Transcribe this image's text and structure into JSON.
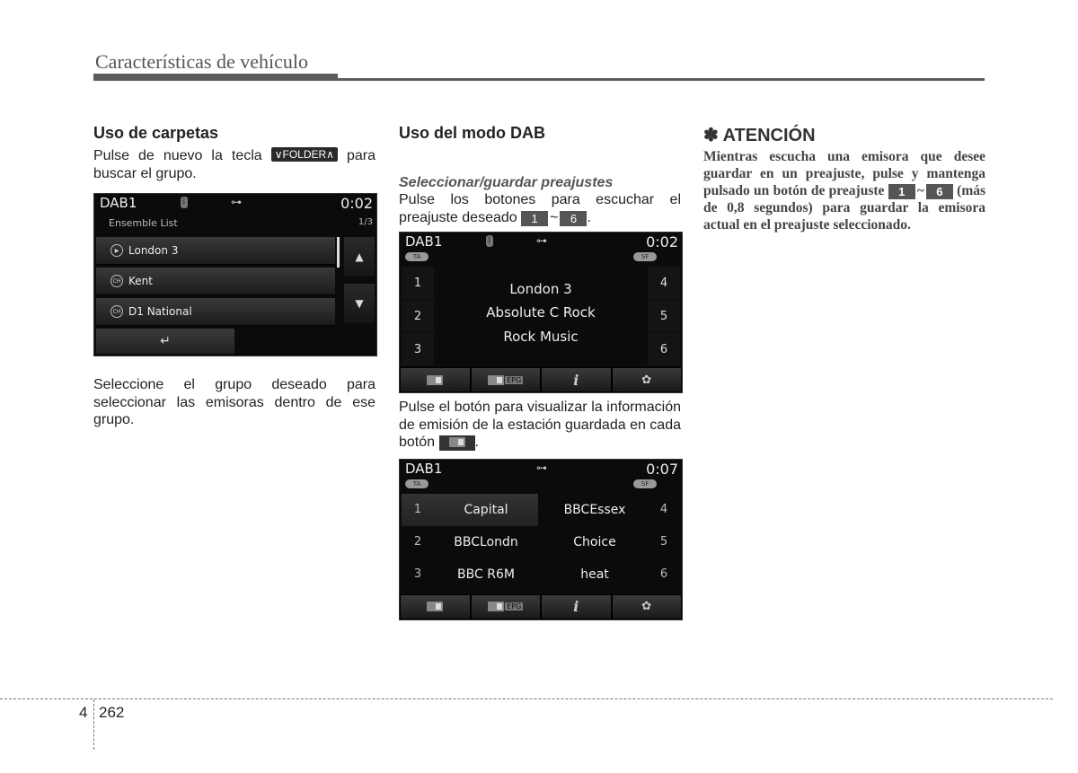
{
  "header": {
    "title": "Características de vehículo"
  },
  "column1": {
    "heading": "Uso de carpetas",
    "para1_before": "Pulse de nuevo la tecla",
    "folder_key": "∨FOLDER∧",
    "para1_after": "para buscar el grupo.",
    "screen": {
      "mode": "DAB1",
      "time": "0:02",
      "subtitle": "Ensemble List",
      "page": "1/3",
      "items": [
        {
          "icon": "play-icon",
          "label": "London 3"
        },
        {
          "icon": "channel-icon",
          "label": "Kent"
        },
        {
          "icon": "channel-icon",
          "label": "D1 National"
        }
      ],
      "up_arrow": "▲",
      "down_arrow": "▼",
      "back_icon": "↵"
    },
    "para2": "Seleccione el grupo deseado para seleccionar las emisoras dentro de ese grupo."
  },
  "column2": {
    "heading": "Uso del modo DAB",
    "subheading": "Seleccionar/guardar preajustes",
    "para1_before": "Pulse los botones  para escuchar el preajuste deseado",
    "key_from": "1",
    "key_sep": "~",
    "key_to": "6",
    "para1_after": ".",
    "screen2": {
      "mode": "DAB1",
      "time": "0:02",
      "ta": "TA",
      "sf": "SF",
      "presets_left": [
        "1",
        "2",
        "3"
      ],
      "presets_right": [
        "4",
        "5",
        "6"
      ],
      "lines": [
        "London 3",
        "Absolute C Rock",
        "Rock Music"
      ],
      "toolbar": [
        "radio-icon",
        "epg-icon",
        "info-icon",
        "gear-icon"
      ],
      "epg_label": "EPG",
      "info_label": "i",
      "gear_label": "✿"
    },
    "para2_before": "Pulse el botón  para visualizar la información de emisión de la estación guardada en cada botón",
    "para2_after": ".",
    "screen3": {
      "mode": "DAB1",
      "time": "0:07",
      "ta": "TA",
      "sf": "SF",
      "left": [
        {
          "n": "1",
          "name": "Capital"
        },
        {
          "n": "2",
          "name": "BBCLondn"
        },
        {
          "n": "3",
          "name": "BBC R6M"
        }
      ],
      "right": [
        {
          "n": "4",
          "name": "BBCEssex"
        },
        {
          "n": "5",
          "name": "Choice"
        },
        {
          "n": "6",
          "name": "heat"
        }
      ],
      "epg_label": "EPG",
      "info_label": "i",
      "gear_label": "✿"
    }
  },
  "column3": {
    "title": "✽ ATENCIÓN",
    "body_before": "Mientras escucha una emisora que desee guardar en un preajuste, pulse y mantenga pulsado un botón de preajuste",
    "key_from": "1",
    "key_sep": "~",
    "key_to": "6",
    "body_after": "(más de 0,8 segundos) para guardar la emisora actual en el preajuste seleccionado."
  },
  "footer": {
    "chapter": "4",
    "page": "262"
  }
}
